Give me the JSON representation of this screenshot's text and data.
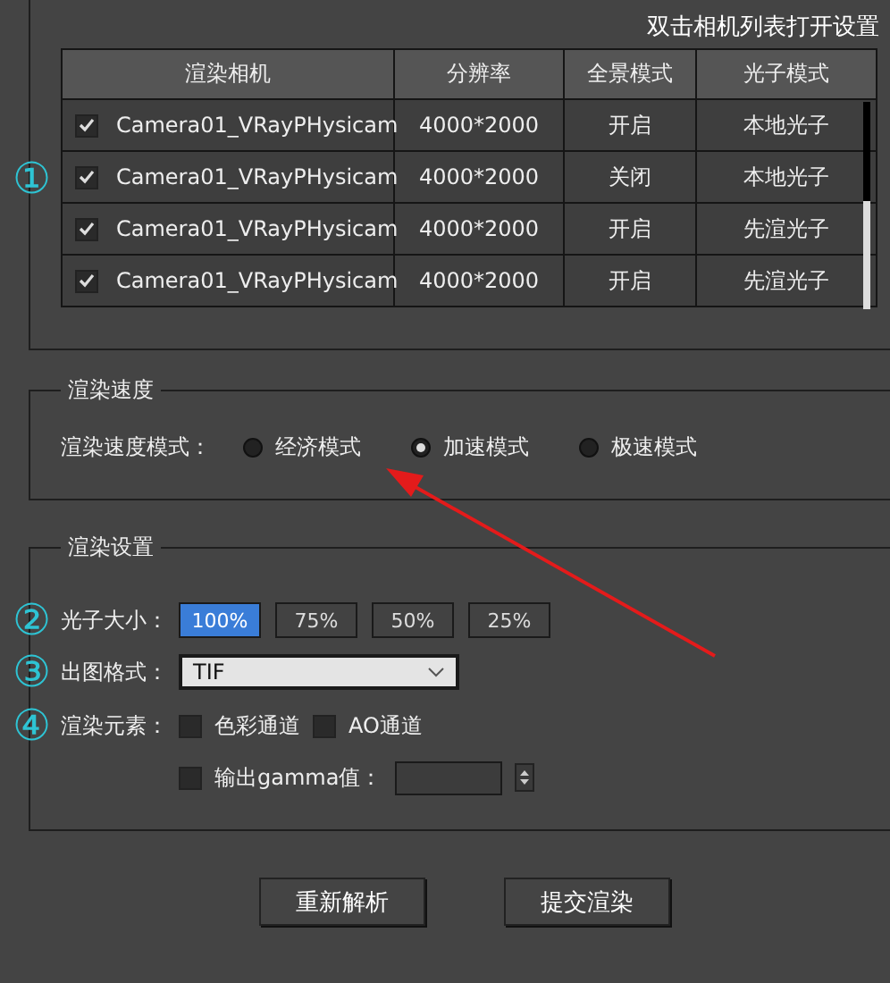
{
  "camera_settings": {
    "hint": "双击相机列表打开设置",
    "marker": "①",
    "table": {
      "columns": [
        "渲染相机",
        "分辨率",
        "全景模式",
        "光子模式"
      ],
      "rows": [
        {
          "checked": true,
          "camera": "Camera01_VRayPHysicam",
          "resolution": "4000*2000",
          "panorama": "开启",
          "photon_mode": "本地光子"
        },
        {
          "checked": true,
          "camera": "Camera01_VRayPHysicam",
          "resolution": "4000*2000",
          "panorama": "关闭",
          "photon_mode": "本地光子"
        },
        {
          "checked": true,
          "camera": "Camera01_VRayPHysicam",
          "resolution": "4000*2000",
          "panorama": "开启",
          "photon_mode": "先渲光子"
        },
        {
          "checked": true,
          "camera": "Camera01_VRayPHysicam",
          "resolution": "4000*2000",
          "panorama": "开启",
          "photon_mode": "先渲光子"
        }
      ]
    }
  },
  "render_speed": {
    "title": "渲染速度",
    "label": "渲染速度模式：",
    "options": [
      {
        "label": "经济模式",
        "selected": false
      },
      {
        "label": "加速模式",
        "selected": true
      },
      {
        "label": "极速模式",
        "selected": false
      }
    ]
  },
  "render_settings": {
    "title": "渲染设置",
    "photon_size": {
      "marker": "②",
      "label": "光子大小：",
      "options": [
        {
          "label": "100%",
          "selected": true
        },
        {
          "label": "75%",
          "selected": false
        },
        {
          "label": "50%",
          "selected": false
        },
        {
          "label": "25%",
          "selected": false
        }
      ]
    },
    "output_format": {
      "marker": "③",
      "label": "出图格式：",
      "value": "TIF"
    },
    "render_elements": {
      "marker": "④",
      "label": "渲染元素：",
      "items": [
        {
          "kind": "checkbox",
          "label": "色彩通道",
          "checked": false
        },
        {
          "kind": "checkbox",
          "label": "AO通道",
          "checked": false
        },
        {
          "kind": "gamma",
          "label": "输出gamma值：",
          "checked": false
        }
      ]
    }
  },
  "buttons": [
    "重新解析",
    "提交渲染"
  ]
}
